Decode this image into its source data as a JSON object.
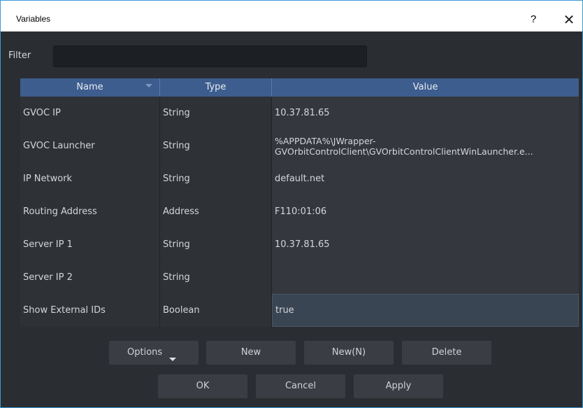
{
  "window": {
    "title": "Variables",
    "help_label": "?",
    "close_label": "✕"
  },
  "filter": {
    "label": "Filter",
    "value": "",
    "placeholder": ""
  },
  "table": {
    "columns": [
      "Name",
      "Type",
      "Value"
    ],
    "rows": [
      {
        "name": "GVOC IP",
        "type": "String",
        "value": "10.37.81.65"
      },
      {
        "name": "GVOC Launcher",
        "type": "String",
        "value": "%APPDATA%\\JWrapper-\nGVOrbitControlClient\\GVOrbitControlClientWinLauncher.e..."
      },
      {
        "name": "IP Network",
        "type": "String",
        "value": "default.net"
      },
      {
        "name": "Routing Address",
        "type": "Address",
        "value": "F110:01:06"
      },
      {
        "name": "Server IP 1",
        "type": "String",
        "value": "10.37.81.65"
      },
      {
        "name": "Server IP 2",
        "type": "String",
        "value": ""
      },
      {
        "name": "Show External IDs",
        "type": "Boolean",
        "value": "true"
      }
    ]
  },
  "buttons": {
    "options": "Options",
    "new": "New",
    "new_n": "New(N)",
    "delete": "Delete",
    "ok": "OK",
    "cancel": "Cancel",
    "apply": "Apply"
  },
  "colors": {
    "header_bg": "#3d5d8e",
    "window_bg": "#2a2d31",
    "border_accent": "#3a9bd6"
  }
}
